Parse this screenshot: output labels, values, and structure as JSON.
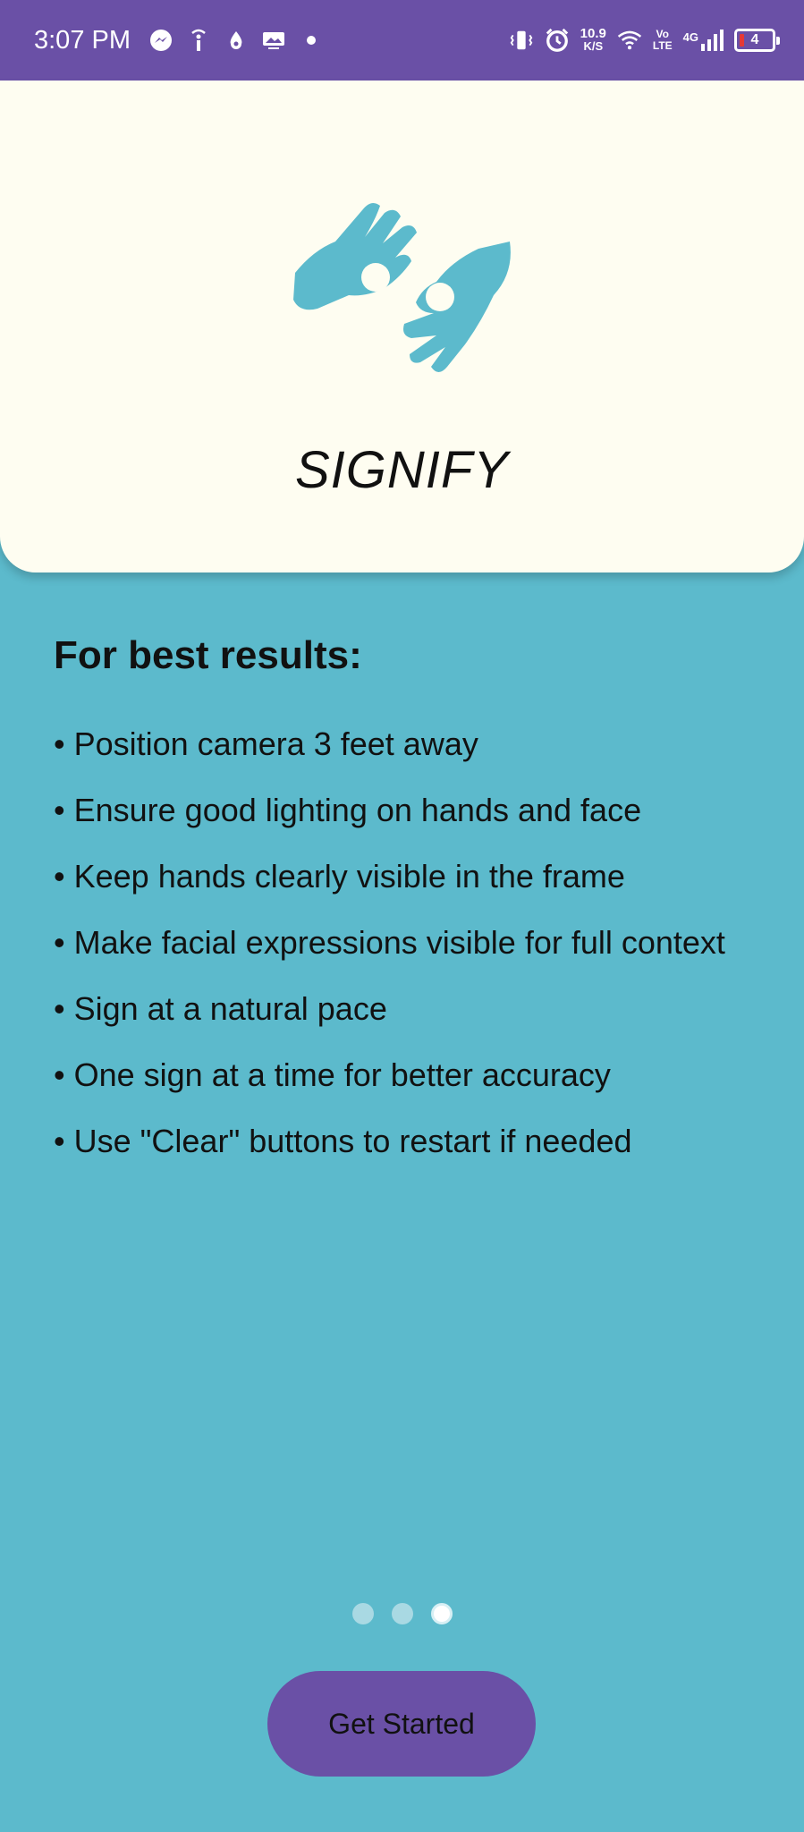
{
  "status_bar": {
    "time": "3:07 PM",
    "net_speed_value": "10.9",
    "net_speed_unit": "K/S",
    "volte_top": "Vo",
    "volte_bottom": "LTE",
    "network_type": "4G",
    "battery_level": "4",
    "icons_left": [
      "messenger-icon",
      "info-notification-icon",
      "drop-icon",
      "image-notification-icon",
      "dot-icon"
    ],
    "icons_right": [
      "vibrate-icon",
      "alarm-icon",
      "wifi-icon",
      "signal-icon",
      "battery-icon"
    ]
  },
  "header": {
    "logo_icon": "sign-language-hands-icon",
    "app_title": "SIGNIFY"
  },
  "tips": {
    "heading": "For best results:",
    "items": [
      "Position camera 3 feet away",
      "Ensure good lighting on hands and face",
      "Keep hands clearly visible in the frame",
      "Make facial expressions visible for full context",
      "Sign at a natural pace",
      "One sign at a time for better accuracy",
      "Use \"Clear\" buttons to restart if needed"
    ]
  },
  "pager": {
    "total": 3,
    "active_index": 2
  },
  "actions": {
    "get_started_label": "Get Started"
  },
  "colors": {
    "status_bar": "#6a50a6",
    "background": "#5cbacc",
    "card": "#fefdf1",
    "logo": "#5cbacc",
    "button": "#6a50a6"
  }
}
